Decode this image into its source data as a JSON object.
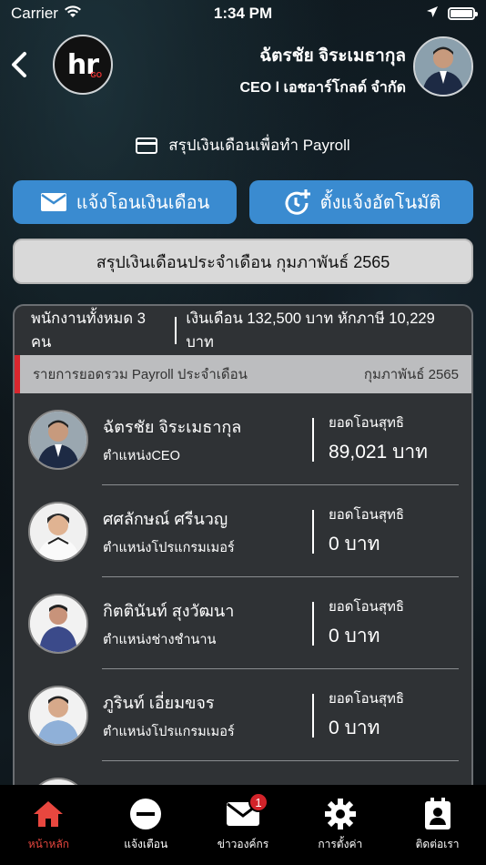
{
  "status_bar": {
    "carrier": "Carrier",
    "time": "1:34 PM"
  },
  "header": {
    "logo_text": "hr",
    "logo_sub": "GO",
    "user_name": "ฉัตรชัย จิระเมธากุล",
    "user_role": "CEO l เอชอาร์โกลด์ จำกัด"
  },
  "section_title": "สรุปเงินเดือนเพื่อทำ Payroll",
  "actions": {
    "notify_transfer": "แจ้งโอนเงินเดือน",
    "auto_notify": "ตั้งแจ้งอัตโนมัติ"
  },
  "month_selector": "สรุปเงินเดือนประจำเดือน กุมภาพันธ์ 2565",
  "summary": {
    "employees": "พนักงานทั้งหมด 3 คน",
    "salary": "เงินเดือน 132,500 บาท หักภาษี 10,229 บาท"
  },
  "payroll_header": {
    "left": "รายการยอดรวม Payroll ประจำเดือน",
    "right": "กุมภาพันธ์ 2565"
  },
  "employees": [
    {
      "name": "ฉัตรชัย จิระเมธากุล",
      "position": "ตำแหน่งCEO",
      "amount_label": "ยอดโอนสุทธิ",
      "amount": "89,021 บาท"
    },
    {
      "name": "ศศลักษณ์ ศรีนวญ",
      "position": "ตำแหน่งโปรแกรมเมอร์",
      "amount_label": "ยอดโอนสุทธิ",
      "amount": "0 บาท"
    },
    {
      "name": "กิตตินันท์ สุงวัฒนา",
      "position": "ตำแหน่งช่างชำนาน",
      "amount_label": "ยอดโอนสุทธิ",
      "amount": "0 บาท"
    },
    {
      "name": "ภูรินท์ เอี่ยมขจร",
      "position": "ตำแหน่งโปรแกรมเมอร์",
      "amount_label": "ยอดโอนสุทธิ",
      "amount": "0 บาท"
    }
  ],
  "tab_bar": {
    "items": [
      {
        "label": "หน้าหลัก",
        "icon": "home-icon"
      },
      {
        "label": "แจ้งเตือน",
        "icon": "minus-circle-icon"
      },
      {
        "label": "ข่าวองค์กร",
        "icon": "mail-icon",
        "badge": "1"
      },
      {
        "label": "การตั้งค่า",
        "icon": "gear-icon"
      },
      {
        "label": "ติดต่อเรา",
        "icon": "contact-icon"
      }
    ]
  },
  "colors": {
    "accent": "#3a8bd0",
    "active_tab": "#e8473f",
    "badge": "#d2232a"
  }
}
